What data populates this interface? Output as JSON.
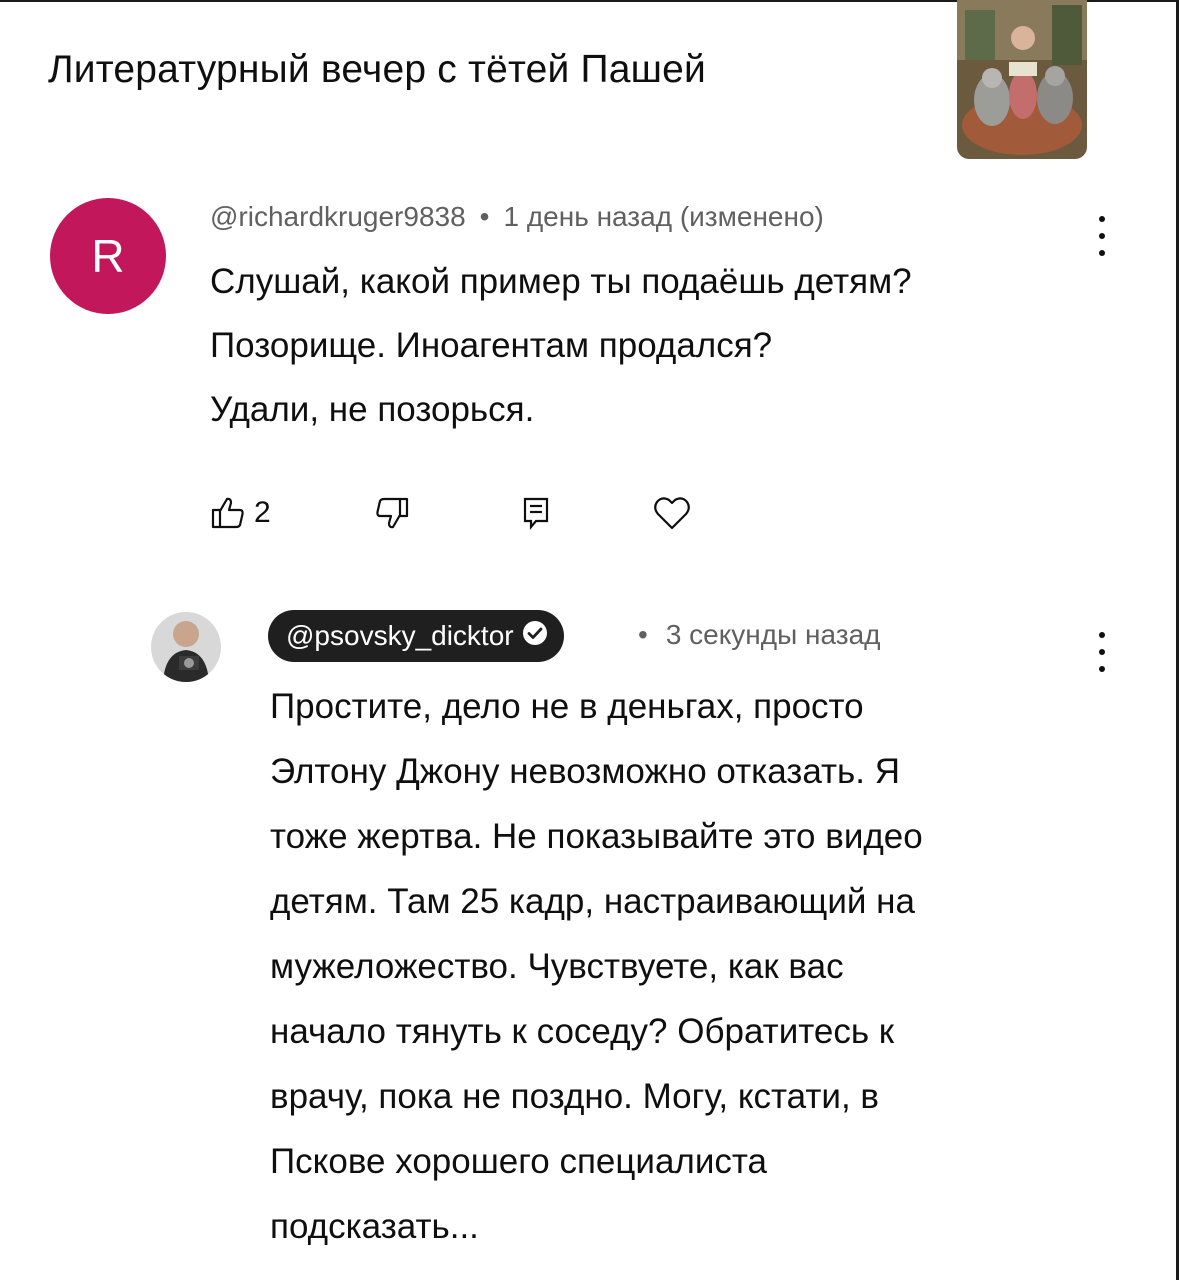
{
  "video": {
    "title": "Литературный вечер с тётей Пашей",
    "thumbnail_icon": "video-thumbnail"
  },
  "comments": [
    {
      "avatar_letter": "R",
      "avatar_color": "#c2185b",
      "handle": "@richardkruger9838",
      "separator": "•",
      "time": "1 день назад (изменено)",
      "text": "Слушай, какой пример ты подаёшь детям?\nПозорище. Иноагентам продался?\nУдали, не позорься.",
      "likes": "2",
      "actions": [
        "like-icon",
        "dislike-icon",
        "reply-icon",
        "heart-icon"
      ]
    },
    {
      "avatar_icon": "photo-avatar",
      "handle": "@psovsky_dicktor",
      "verified": true,
      "separator": "•",
      "time": "3 секунды назад",
      "text": "Простите, дело не в деньгах, просто\nЭлтону Джону невозможно отказать. Я\nтоже жертва. Не показывайте это видео\nдетям. Там 25 кадр, настраивающий на\nмужеложество. Чувствуете, как вас\nначало тянуть к соседу? Обратитесь к\nврачу, пока не поздно. Могу, кстати, в\nПскове хорошего специалиста\nподсказать..."
    }
  ]
}
